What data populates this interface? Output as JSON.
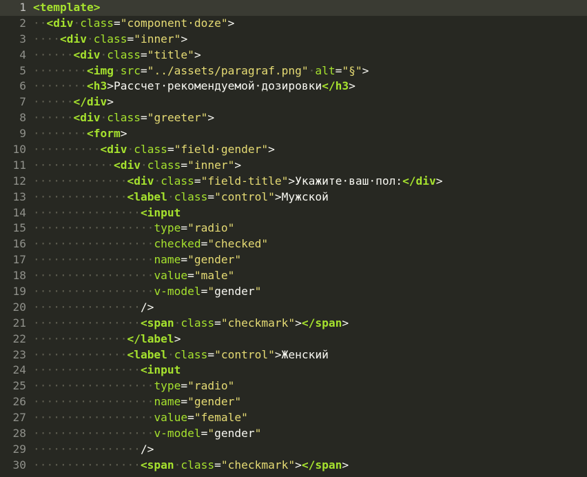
{
  "editor": {
    "lines": [
      {
        "n": "1",
        "current": true,
        "tokens": [
          [
            "t",
            "<template>"
          ]
        ]
      },
      {
        "n": "2",
        "tokens": [
          [
            "ws",
            "··"
          ],
          [
            "t",
            "<div"
          ],
          [
            "ws",
            "·"
          ],
          [
            "a",
            "class"
          ],
          [
            "p",
            "="
          ],
          [
            "s",
            "\"component·doze\""
          ],
          [
            "p",
            ">"
          ]
        ]
      },
      {
        "n": "3",
        "tokens": [
          [
            "ws",
            "····"
          ],
          [
            "t",
            "<div"
          ],
          [
            "ws",
            "·"
          ],
          [
            "a",
            "class"
          ],
          [
            "p",
            "="
          ],
          [
            "s",
            "\"inner\""
          ],
          [
            "p",
            ">"
          ]
        ]
      },
      {
        "n": "4",
        "tokens": [
          [
            "ws",
            "······"
          ],
          [
            "t",
            "<div"
          ],
          [
            "ws",
            "·"
          ],
          [
            "a",
            "class"
          ],
          [
            "p",
            "="
          ],
          [
            "s",
            "\"title\""
          ],
          [
            "p",
            ">"
          ]
        ]
      },
      {
        "n": "5",
        "tokens": [
          [
            "ws",
            "········"
          ],
          [
            "t",
            "<img"
          ],
          [
            "ws",
            "·"
          ],
          [
            "a",
            "src"
          ],
          [
            "p",
            "="
          ],
          [
            "s",
            "\"../assets/paragraf.png\""
          ],
          [
            "ws",
            "·"
          ],
          [
            "a",
            "alt"
          ],
          [
            "p",
            "="
          ],
          [
            "s",
            "\"§\""
          ],
          [
            "p",
            ">"
          ]
        ]
      },
      {
        "n": "6",
        "tokens": [
          [
            "ws",
            "········"
          ],
          [
            "t",
            "<h3"
          ],
          [
            "p",
            ">"
          ],
          [
            "x",
            "Рассчет·рекомендуемой·дозировки"
          ],
          [
            "t",
            "</h3"
          ],
          [
            "p",
            ">"
          ]
        ]
      },
      {
        "n": "7",
        "tokens": [
          [
            "ws",
            "······"
          ],
          [
            "t",
            "</div"
          ],
          [
            "p",
            ">"
          ]
        ]
      },
      {
        "n": "8",
        "tokens": [
          [
            "ws",
            "······"
          ],
          [
            "t",
            "<div"
          ],
          [
            "ws",
            "·"
          ],
          [
            "a",
            "class"
          ],
          [
            "p",
            "="
          ],
          [
            "s",
            "\"greeter\""
          ],
          [
            "p",
            ">"
          ]
        ]
      },
      {
        "n": "9",
        "tokens": [
          [
            "ws",
            "········"
          ],
          [
            "t",
            "<form"
          ],
          [
            "p",
            ">"
          ]
        ]
      },
      {
        "n": "10",
        "tokens": [
          [
            "ws",
            "··········"
          ],
          [
            "t",
            "<div"
          ],
          [
            "ws",
            "·"
          ],
          [
            "a",
            "class"
          ],
          [
            "p",
            "="
          ],
          [
            "s",
            "\"field·gender\""
          ],
          [
            "p",
            ">"
          ]
        ]
      },
      {
        "n": "11",
        "tokens": [
          [
            "ws",
            "············"
          ],
          [
            "t",
            "<div"
          ],
          [
            "ws",
            "·"
          ],
          [
            "a",
            "class"
          ],
          [
            "p",
            "="
          ],
          [
            "s",
            "\"inner\""
          ],
          [
            "p",
            ">"
          ]
        ]
      },
      {
        "n": "12",
        "tokens": [
          [
            "ws",
            "··············"
          ],
          [
            "t",
            "<div"
          ],
          [
            "ws",
            "·"
          ],
          [
            "a",
            "class"
          ],
          [
            "p",
            "="
          ],
          [
            "s",
            "\"field-title\""
          ],
          [
            "p",
            ">"
          ],
          [
            "x",
            "Укажите·ваш·пол:"
          ],
          [
            "t",
            "</div"
          ],
          [
            "p",
            ">"
          ]
        ]
      },
      {
        "n": "13",
        "tokens": [
          [
            "ws",
            "··············"
          ],
          [
            "t",
            "<label"
          ],
          [
            "ws",
            "·"
          ],
          [
            "a",
            "class"
          ],
          [
            "p",
            "="
          ],
          [
            "s",
            "\"control\""
          ],
          [
            "p",
            ">"
          ],
          [
            "x",
            "Мужской"
          ]
        ]
      },
      {
        "n": "14",
        "tokens": [
          [
            "ws",
            "················"
          ],
          [
            "t",
            "<input"
          ]
        ]
      },
      {
        "n": "15",
        "tokens": [
          [
            "ws",
            "··················"
          ],
          [
            "a",
            "type"
          ],
          [
            "p",
            "="
          ],
          [
            "s",
            "\"radio\""
          ]
        ]
      },
      {
        "n": "16",
        "tokens": [
          [
            "ws",
            "··················"
          ],
          [
            "a",
            "checked"
          ],
          [
            "p",
            "="
          ],
          [
            "s",
            "\"checked\""
          ]
        ]
      },
      {
        "n": "17",
        "tokens": [
          [
            "ws",
            "··················"
          ],
          [
            "a",
            "name"
          ],
          [
            "p",
            "="
          ],
          [
            "s",
            "\"gender\""
          ]
        ]
      },
      {
        "n": "18",
        "tokens": [
          [
            "ws",
            "··················"
          ],
          [
            "a",
            "value"
          ],
          [
            "p",
            "="
          ],
          [
            "s",
            "\"male\""
          ]
        ]
      },
      {
        "n": "19",
        "tokens": [
          [
            "ws",
            "··················"
          ],
          [
            "a",
            "v-model"
          ],
          [
            "p",
            "="
          ],
          [
            "s",
            "\""
          ],
          [
            "x",
            "gender"
          ],
          [
            "s",
            "\""
          ]
        ]
      },
      {
        "n": "20",
        "tokens": [
          [
            "ws",
            "················"
          ],
          [
            "p",
            "/>"
          ]
        ]
      },
      {
        "n": "21",
        "tokens": [
          [
            "ws",
            "················"
          ],
          [
            "t",
            "<span"
          ],
          [
            "ws",
            "·"
          ],
          [
            "a",
            "class"
          ],
          [
            "p",
            "="
          ],
          [
            "s",
            "\"checkmark\""
          ],
          [
            "p",
            ">"
          ],
          [
            "t",
            "</span"
          ],
          [
            "p",
            ">"
          ]
        ]
      },
      {
        "n": "22",
        "tokens": [
          [
            "ws",
            "··············"
          ],
          [
            "t",
            "</label"
          ],
          [
            "p",
            ">"
          ]
        ]
      },
      {
        "n": "23",
        "tokens": [
          [
            "ws",
            "··············"
          ],
          [
            "t",
            "<label"
          ],
          [
            "ws",
            "·"
          ],
          [
            "a",
            "class"
          ],
          [
            "p",
            "="
          ],
          [
            "s",
            "\"control\""
          ],
          [
            "p",
            ">"
          ],
          [
            "x",
            "Женский"
          ]
        ]
      },
      {
        "n": "24",
        "tokens": [
          [
            "ws",
            "················"
          ],
          [
            "t",
            "<input"
          ]
        ]
      },
      {
        "n": "25",
        "tokens": [
          [
            "ws",
            "··················"
          ],
          [
            "a",
            "type"
          ],
          [
            "p",
            "="
          ],
          [
            "s",
            "\"radio\""
          ]
        ]
      },
      {
        "n": "26",
        "tokens": [
          [
            "ws",
            "··················"
          ],
          [
            "a",
            "name"
          ],
          [
            "p",
            "="
          ],
          [
            "s",
            "\"gender\""
          ]
        ]
      },
      {
        "n": "27",
        "tokens": [
          [
            "ws",
            "··················"
          ],
          [
            "a",
            "value"
          ],
          [
            "p",
            "="
          ],
          [
            "s",
            "\"female\""
          ]
        ]
      },
      {
        "n": "28",
        "tokens": [
          [
            "ws",
            "··················"
          ],
          [
            "a",
            "v-model"
          ],
          [
            "p",
            "="
          ],
          [
            "s",
            "\""
          ],
          [
            "x",
            "gender"
          ],
          [
            "s",
            "\""
          ]
        ]
      },
      {
        "n": "29",
        "tokens": [
          [
            "ws",
            "················"
          ],
          [
            "p",
            "/>"
          ]
        ]
      },
      {
        "n": "30",
        "tokens": [
          [
            "ws",
            "················"
          ],
          [
            "t",
            "<span"
          ],
          [
            "ws",
            "·"
          ],
          [
            "a",
            "class"
          ],
          [
            "p",
            "="
          ],
          [
            "s",
            "\"checkmark\""
          ],
          [
            "p",
            ">"
          ],
          [
            "t",
            "</span"
          ],
          [
            "p",
            ">"
          ]
        ]
      }
    ],
    "colors": {
      "background": "#272822",
      "tag": "#a6e22e",
      "string": "#e6db74",
      "text": "#f8f8f2",
      "whitespace": "#5f5e51",
      "gutter": "#8f908a"
    }
  }
}
